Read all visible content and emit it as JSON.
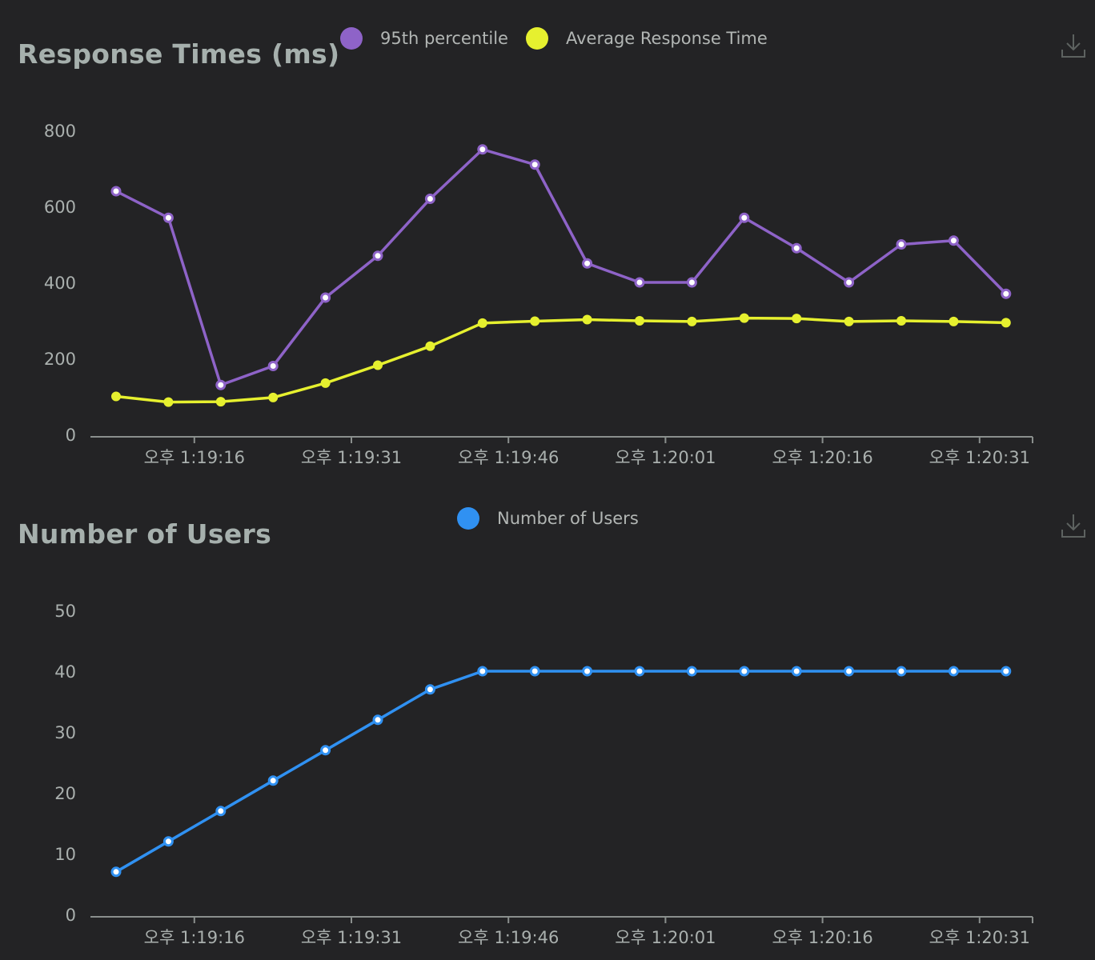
{
  "theme": {
    "background": "#232325",
    "axis_color": "#8a8f8d",
    "text_color": "#aab0ae",
    "colors": {
      "p95": "#8e63c8",
      "avg": "#e6f02f",
      "users": "#3091f2"
    }
  },
  "download_icon": "download-icon",
  "charts": {
    "response_times": {
      "title": "Response Times (ms)",
      "legend": [
        {
          "label": "95th percentile",
          "color": "#8e63c8"
        },
        {
          "label": "Average Response Time",
          "color": "#e6f02f"
        }
      ]
    },
    "users": {
      "title": "Number of Users",
      "legend": [
        {
          "label": "Number of Users",
          "color": "#3091f2"
        }
      ]
    }
  },
  "chart_data": [
    {
      "type": "line",
      "title": "Response Times (ms)",
      "xlabel": "",
      "ylabel": "",
      "ylim": [
        0,
        800
      ],
      "yticks": [
        0,
        200,
        400,
        600,
        800
      ],
      "x_tick_labels": [
        "오후 1:19:16",
        "오후 1:19:31",
        "오후 1:19:46",
        "오후 1:20:01",
        "오후 1:20:16",
        "오후 1:20:31"
      ],
      "x": [
        "1:19:06",
        "1:19:11",
        "1:19:16",
        "1:19:21",
        "1:19:26",
        "1:19:31",
        "1:19:36",
        "1:19:41",
        "1:19:46",
        "1:19:51",
        "1:19:56",
        "1:20:01",
        "1:20:06",
        "1:20:11",
        "1:20:16",
        "1:20:21",
        "1:20:26",
        "1:20:31"
      ],
      "series": [
        {
          "name": "95th percentile",
          "color": "#8e63c8",
          "values": [
            640,
            570,
            130,
            180,
            360,
            470,
            620,
            750,
            710,
            450,
            400,
            400,
            570,
            490,
            400,
            500,
            510,
            370
          ]
        },
        {
          "name": "Average Response Time",
          "color": "#e6f02f",
          "values": [
            100,
            85,
            86,
            97,
            135,
            182,
            232,
            293,
            298,
            302,
            299,
            297,
            306,
            305,
            297,
            299,
            297,
            294
          ]
        }
      ],
      "legend": "top",
      "grid": false
    },
    {
      "type": "line",
      "title": "Number of Users",
      "xlabel": "",
      "ylabel": "",
      "ylim": [
        0,
        50
      ],
      "yticks": [
        0,
        10,
        20,
        30,
        40,
        50
      ],
      "x_tick_labels": [
        "오후 1:19:16",
        "오후 1:19:31",
        "오후 1:19:46",
        "오후 1:20:01",
        "오후 1:20:16",
        "오후 1:20:31"
      ],
      "x": [
        "1:19:06",
        "1:19:11",
        "1:19:16",
        "1:19:21",
        "1:19:26",
        "1:19:31",
        "1:19:36",
        "1:19:41",
        "1:19:46",
        "1:19:51",
        "1:19:56",
        "1:20:01",
        "1:20:06",
        "1:20:11",
        "1:20:16",
        "1:20:21",
        "1:20:26",
        "1:20:31"
      ],
      "series": [
        {
          "name": "Number of Users",
          "color": "#3091f2",
          "values": [
            7,
            12,
            17,
            22,
            27,
            32,
            37,
            40,
            40,
            40,
            40,
            40,
            40,
            40,
            40,
            40,
            40,
            40
          ]
        }
      ],
      "legend": "top",
      "grid": false
    }
  ]
}
